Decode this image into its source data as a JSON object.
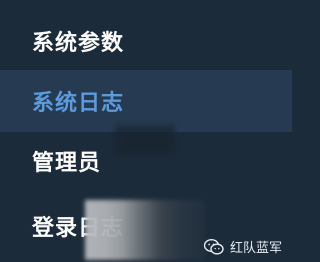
{
  "menu": {
    "items": [
      {
        "label": "系统参数",
        "active": false
      },
      {
        "label": "系统日志",
        "active": true
      },
      {
        "label": "管理员",
        "active": false
      },
      {
        "label": "登录日志",
        "active": false
      }
    ]
  },
  "watermark": {
    "icon": "wechat-icon",
    "text": "红队蓝军"
  },
  "colors": {
    "background": "#1c2b3a",
    "active_background": "#263b52",
    "active_text": "#5b9be0",
    "text": "#ffffff"
  }
}
